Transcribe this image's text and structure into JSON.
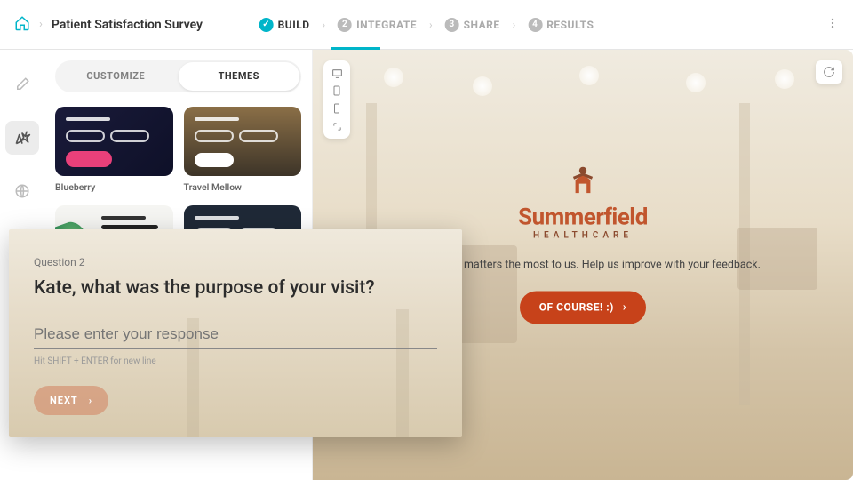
{
  "breadcrumb": {
    "title": "Patient Satisfaction Survey"
  },
  "nav": {
    "steps": [
      {
        "label": "BUILD",
        "active": true
      },
      {
        "label": "INTEGRATE",
        "num": "2"
      },
      {
        "label": "SHARE",
        "num": "3"
      },
      {
        "label": "RESULTS",
        "num": "4"
      }
    ]
  },
  "sidebar": {
    "seg_customize": "CUSTOMIZE",
    "seg_themes": "THEMES",
    "themes": [
      {
        "name": "Blueberry"
      },
      {
        "name": "Travel Mellow"
      }
    ]
  },
  "welcome": {
    "brand": "Summerfield",
    "brand_sub": "HEALTHCARE",
    "tagline": "Your health matters the most to us. Help us improve with your feedback.",
    "cta": "OF COURSE! :)"
  },
  "question": {
    "num_label": "Question 2",
    "text": "Kate, what was the purpose of your visit?",
    "placeholder": "Please enter your response",
    "hint": "Hit SHIFT + ENTER for new line",
    "next_label": "NEXT"
  }
}
